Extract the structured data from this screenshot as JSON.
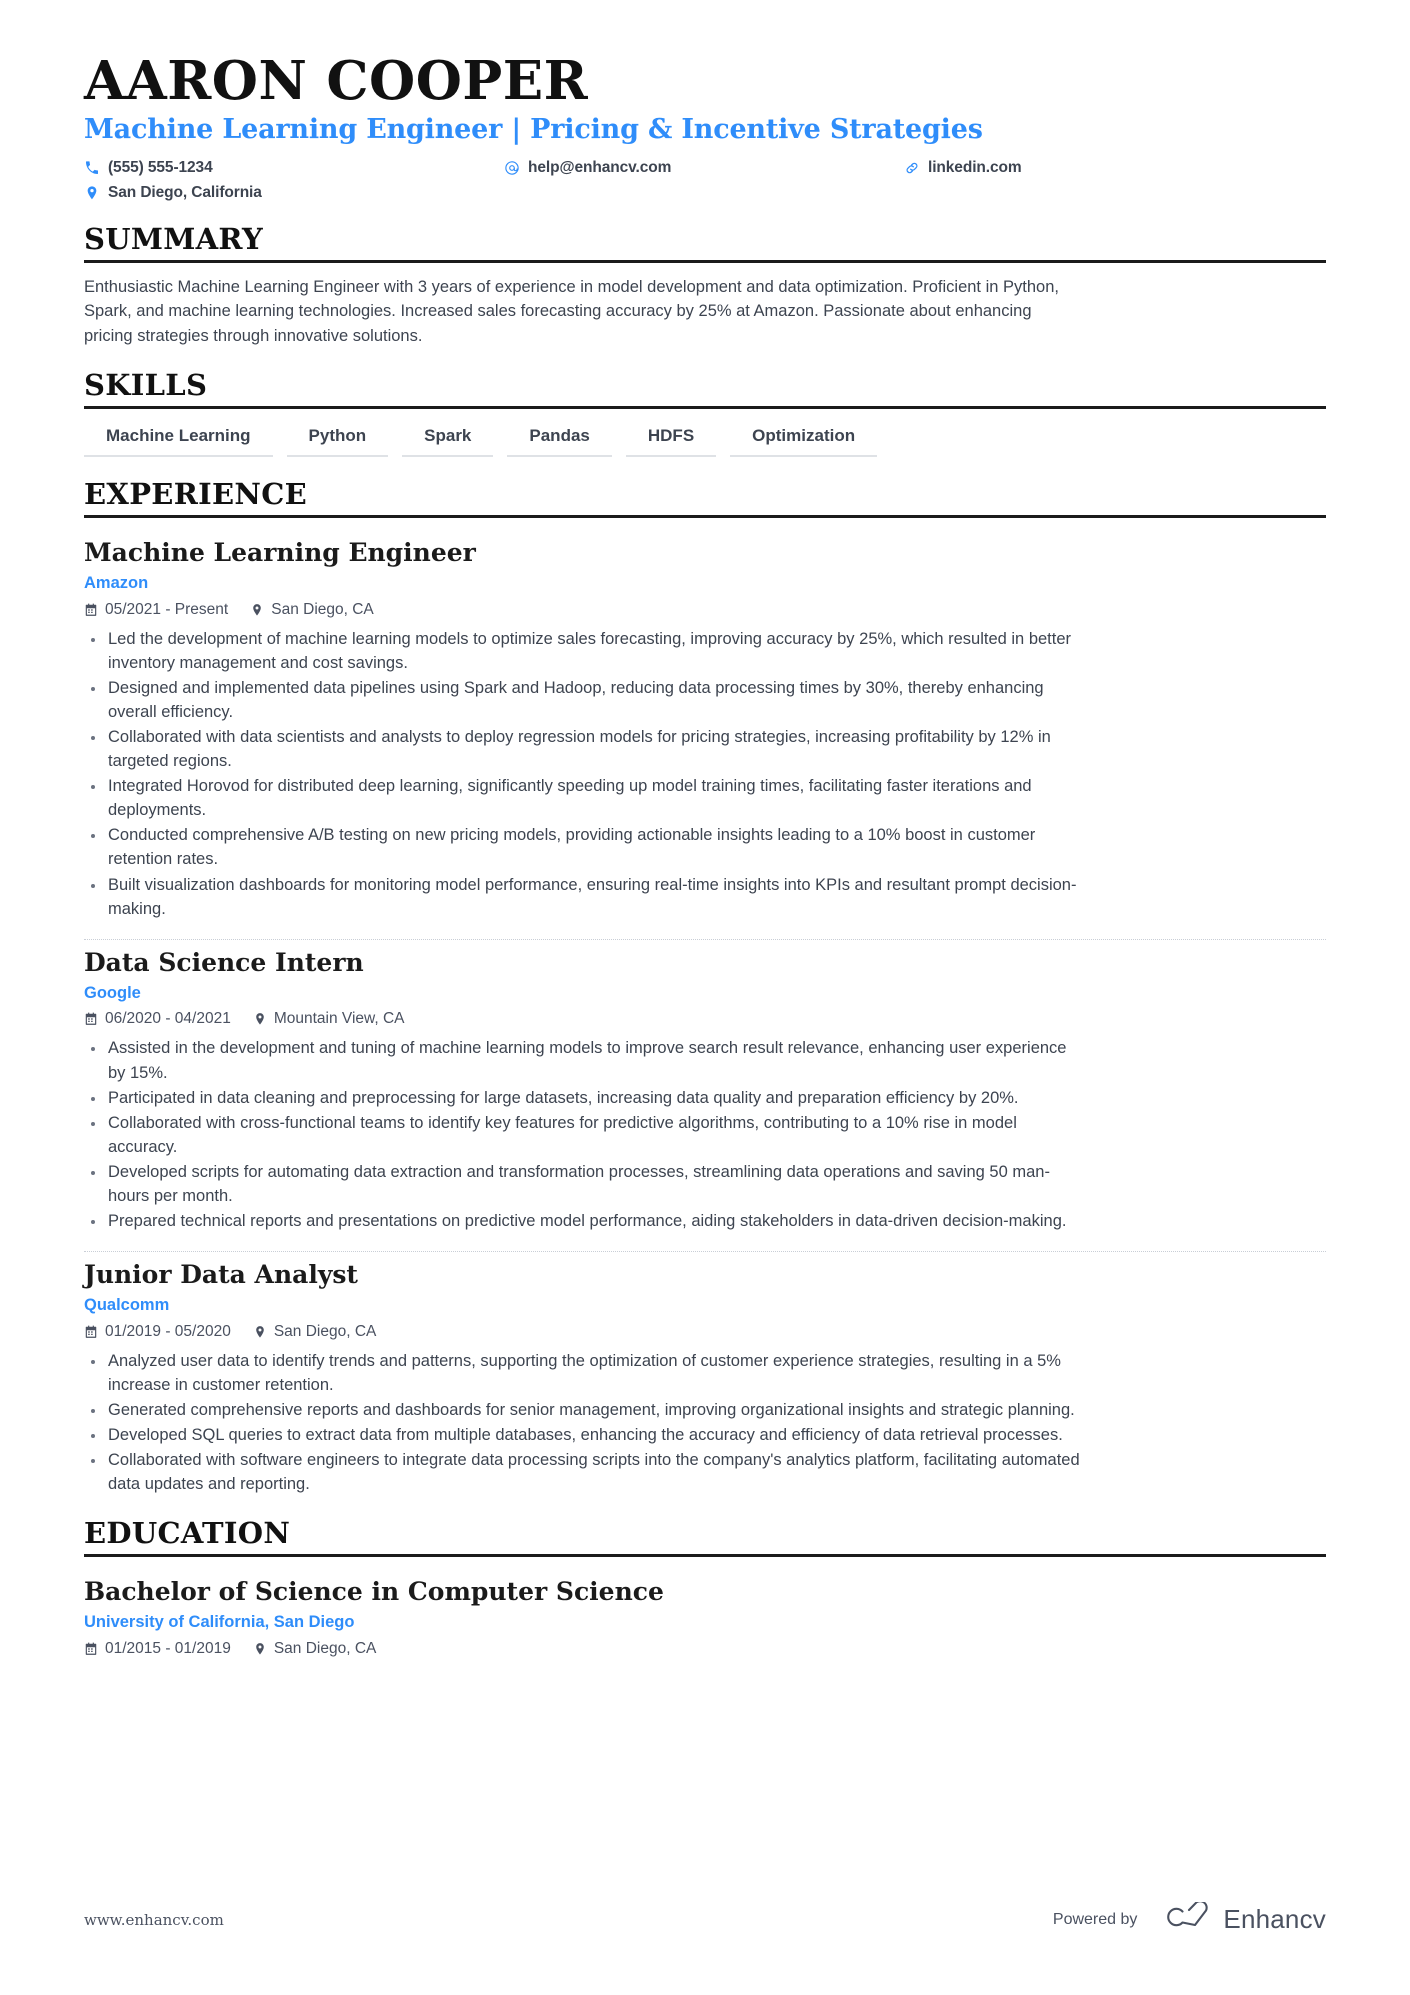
{
  "header": {
    "name": "AARON COOPER",
    "headline": "Machine Learning Engineer | Pricing & Incentive Strategies",
    "contacts": [
      {
        "icon": "phone-icon",
        "value": "(555) 555-1234"
      },
      {
        "icon": "email-icon",
        "value": "help@enhancv.com"
      },
      {
        "icon": "link-icon",
        "value": "linkedin.com"
      },
      {
        "icon": "location-icon",
        "value": "San Diego, California"
      }
    ]
  },
  "summary": {
    "title": "SUMMARY",
    "text": "Enthusiastic Machine Learning Engineer with 3 years of experience in model development and data optimization. Proficient in Python, Spark, and machine learning technologies. Increased sales forecasting accuracy by 25% at Amazon. Passionate about enhancing pricing strategies through innovative solutions."
  },
  "skills": {
    "title": "SKILLS",
    "items": [
      "Machine Learning",
      "Python",
      "Spark",
      "Pandas",
      "HDFS",
      "Optimization"
    ]
  },
  "experience": {
    "title": "EXPERIENCE",
    "entries": [
      {
        "role": "Machine Learning Engineer",
        "company": "Amazon",
        "dates": "05/2021 - Present",
        "location": "San Diego, CA",
        "bullets": [
          "Led the development of machine learning models to optimize sales forecasting, improving accuracy by 25%, which resulted in better inventory management and cost savings.",
          "Designed and implemented data pipelines using Spark and Hadoop, reducing data processing times by 30%, thereby enhancing overall efficiency.",
          "Collaborated with data scientists and analysts to deploy regression models for pricing strategies, increasing profitability by 12% in targeted regions.",
          "Integrated Horovod for distributed deep learning, significantly speeding up model training times, facilitating faster iterations and deployments.",
          "Conducted comprehensive A/B testing on new pricing models, providing actionable insights leading to a 10% boost in customer retention rates.",
          "Built visualization dashboards for monitoring model performance, ensuring real-time insights into KPIs and resultant prompt decision-making."
        ]
      },
      {
        "role": "Data Science Intern",
        "company": "Google",
        "dates": "06/2020 - 04/2021",
        "location": "Mountain View, CA",
        "bullets": [
          "Assisted in the development and tuning of machine learning models to improve search result relevance, enhancing user experience by 15%.",
          "Participated in data cleaning and preprocessing for large datasets, increasing data quality and preparation efficiency by 20%.",
          "Collaborated with cross-functional teams to identify key features for predictive algorithms, contributing to a 10% rise in model accuracy.",
          "Developed scripts for automating data extraction and transformation processes, streamlining data operations and saving 50 man-hours per month.",
          "Prepared technical reports and presentations on predictive model performance, aiding stakeholders in data-driven decision-making."
        ]
      },
      {
        "role": "Junior Data Analyst",
        "company": "Qualcomm",
        "dates": "01/2019 - 05/2020",
        "location": "San Diego, CA",
        "bullets": [
          "Analyzed user data to identify trends and patterns, supporting the optimization of customer experience strategies, resulting in a 5% increase in customer retention.",
          "Generated comprehensive reports and dashboards for senior management, improving organizational insights and strategic planning.",
          "Developed SQL queries to extract data from multiple databases, enhancing the accuracy and efficiency of data retrieval processes.",
          "Collaborated with software engineers to integrate data processing scripts into the company's analytics platform, facilitating automated data updates and reporting."
        ]
      }
    ]
  },
  "education": {
    "title": "EDUCATION",
    "entries": [
      {
        "degree": "Bachelor of Science in Computer Science",
        "school": "University of California, San Diego",
        "dates": "01/2015 - 01/2019",
        "location": "San Diego, CA"
      }
    ]
  },
  "footer": {
    "url": "www.enhancv.com",
    "powered_by": "Powered by",
    "brand": "Enhancv"
  },
  "colors": {
    "accent": "#2f8dfa",
    "body_text": "#3d4450",
    "heading": "#111111",
    "rule": "#1b1b1b",
    "chip_underline": "#dfe2e6"
  }
}
